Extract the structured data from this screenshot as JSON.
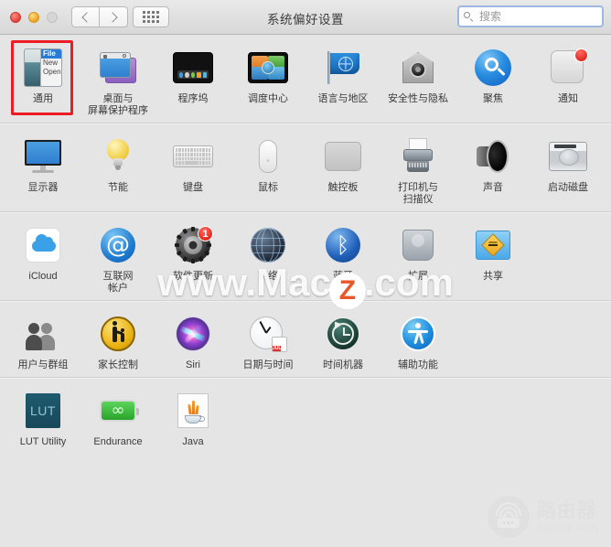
{
  "window": {
    "title": "系统偏好设置",
    "traffic_lights": [
      "close",
      "minimize",
      "zoom"
    ],
    "nav": {
      "back_label": "‹",
      "forward_label": "›",
      "showall_label": "grid-icon"
    },
    "search": {
      "placeholder": "搜索",
      "value": ""
    }
  },
  "sections": [
    {
      "name": "personal",
      "items": [
        {
          "label": "通用",
          "icon": "general-icon",
          "selected": true,
          "badge": null
        },
        {
          "label": "桌面与\n屏幕保护程序",
          "icon": "desktop-screensaver-icon",
          "selected": false,
          "badge": null
        },
        {
          "label": "程序坞",
          "icon": "dock-icon",
          "selected": false,
          "badge": null
        },
        {
          "label": "调度中心",
          "icon": "mission-control-icon",
          "selected": false,
          "badge": null
        },
        {
          "label": "语言与地区",
          "icon": "language-region-icon",
          "selected": false,
          "badge": null
        },
        {
          "label": "安全性与隐私",
          "icon": "security-privacy-icon",
          "selected": false,
          "badge": null
        },
        {
          "label": "聚焦",
          "icon": "spotlight-icon",
          "selected": false,
          "badge": null
        },
        {
          "label": "通知",
          "icon": "notifications-icon",
          "selected": false,
          "badge": ""
        }
      ]
    },
    {
      "name": "hardware",
      "items": [
        {
          "label": "显示器",
          "icon": "displays-icon",
          "selected": false,
          "badge": null
        },
        {
          "label": "节能",
          "icon": "energy-saver-icon",
          "selected": false,
          "badge": null
        },
        {
          "label": "键盘",
          "icon": "keyboard-icon",
          "selected": false,
          "badge": null
        },
        {
          "label": "鼠标",
          "icon": "mouse-icon",
          "selected": false,
          "badge": null
        },
        {
          "label": "触控板",
          "icon": "trackpad-icon",
          "selected": false,
          "badge": null
        },
        {
          "label": "打印机与\n扫描仪",
          "icon": "printers-scanners-icon",
          "selected": false,
          "badge": null
        },
        {
          "label": "声音",
          "icon": "sound-icon",
          "selected": false,
          "badge": null
        },
        {
          "label": "启动磁盘",
          "icon": "startup-disk-icon",
          "selected": false,
          "badge": null
        }
      ]
    },
    {
      "name": "internet-wireless",
      "items": [
        {
          "label": "iCloud",
          "icon": "icloud-icon",
          "selected": false,
          "badge": null
        },
        {
          "label": "互联网\n帐户",
          "icon": "internet-accounts-icon",
          "selected": false,
          "badge": null
        },
        {
          "label": "软件更新",
          "icon": "software-update-icon",
          "selected": false,
          "badge": "1"
        },
        {
          "label": "网络",
          "icon": "network-icon",
          "selected": false,
          "badge": null
        },
        {
          "label": "蓝牙",
          "icon": "bluetooth-icon",
          "selected": false,
          "badge": null
        },
        {
          "label": "扩展",
          "icon": "extensions-icon",
          "selected": false,
          "badge": null
        },
        {
          "label": "共享",
          "icon": "sharing-icon",
          "selected": false,
          "badge": null
        }
      ]
    },
    {
      "name": "system",
      "items": [
        {
          "label": "用户与群组",
          "icon": "users-groups-icon",
          "selected": false,
          "badge": null
        },
        {
          "label": "家长控制",
          "icon": "parental-controls-icon",
          "selected": false,
          "badge": null
        },
        {
          "label": "Siri",
          "icon": "siri-icon",
          "selected": false,
          "badge": null
        },
        {
          "label": "日期与时间",
          "icon": "date-time-icon",
          "selected": false,
          "badge": null
        },
        {
          "label": "时间机器",
          "icon": "time-machine-icon",
          "selected": false,
          "badge": null
        },
        {
          "label": "辅助功能",
          "icon": "accessibility-icon",
          "selected": false,
          "badge": null
        }
      ]
    },
    {
      "name": "third-party",
      "items": [
        {
          "label": "LUT Utility",
          "icon": "lut-utility-icon",
          "selected": false,
          "badge": null
        },
        {
          "label": "Endurance",
          "icon": "endurance-icon",
          "selected": false,
          "badge": null
        },
        {
          "label": "Java",
          "icon": "java-icon",
          "selected": false,
          "badge": null
        }
      ]
    }
  ],
  "icon_details": {
    "general_menu": {
      "title": "File",
      "items": [
        "New",
        "Open"
      ]
    },
    "date_time": {
      "month": "JUL",
      "day": "18"
    },
    "lut_text": "LUT",
    "bluetooth_glyph": "ᛒ",
    "at_glyph": "@",
    "endurance_glyph": "∞"
  },
  "watermarks": {
    "macz": {
      "prefix": "www.Mac",
      "mark": "Z",
      "suffix": ".com"
    },
    "router": {
      "title": "路由器",
      "url": "luyouqi.com"
    }
  },
  "colors": {
    "selection_red": "#ee1c25",
    "badge_red": "#e0251c",
    "search_focus_blue": "#9cb8e0",
    "window_bg": "#e5e5e5"
  }
}
